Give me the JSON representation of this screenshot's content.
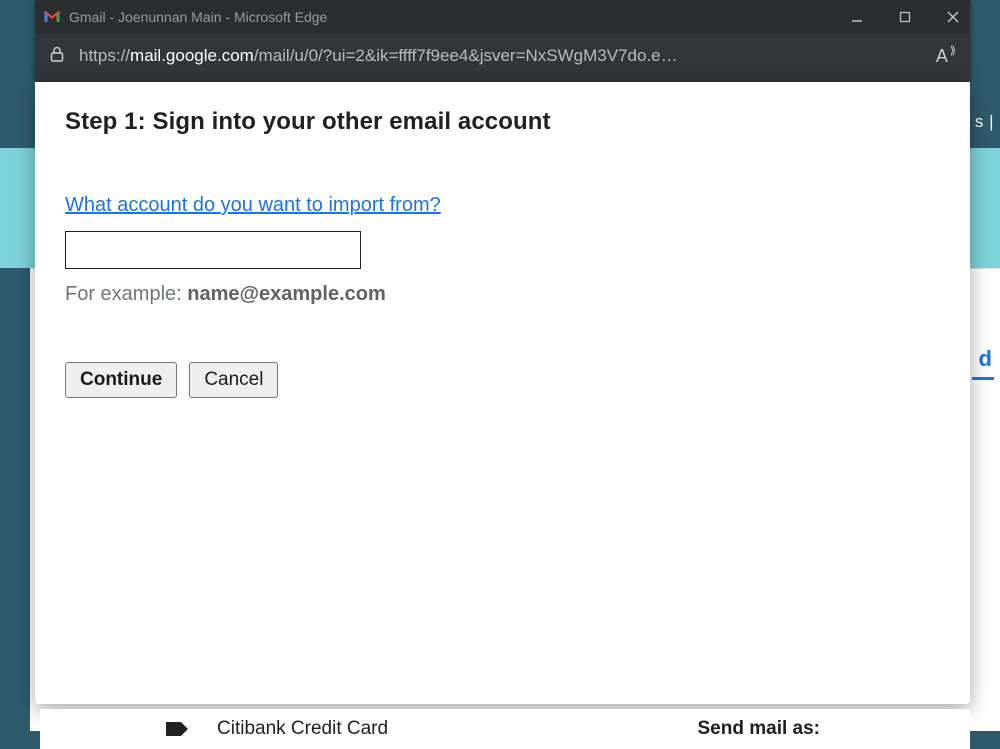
{
  "window": {
    "title": "Gmail - Joenunnan Main - Microsoft Edge"
  },
  "addressbar": {
    "prefix": "https://",
    "host": "mail.google.com",
    "path": "/mail/u/0/?ui=2&ik=ffff7f9ee4&jsver=NxSWgM3V7do.e…"
  },
  "modal": {
    "title": "Step 1: Sign into your other email account",
    "question": "What account do you want to import from?",
    "example_prefix": "For example: ",
    "example_email": "name@example.com",
    "email_value": "",
    "continue_label": "Continue",
    "cancel_label": "Cancel"
  },
  "behind": {
    "top_right_fragment": "s |",
    "blue_letter": "d",
    "label_name": "Citibank Credit Card",
    "send_mail_label": "Send mail as:"
  }
}
